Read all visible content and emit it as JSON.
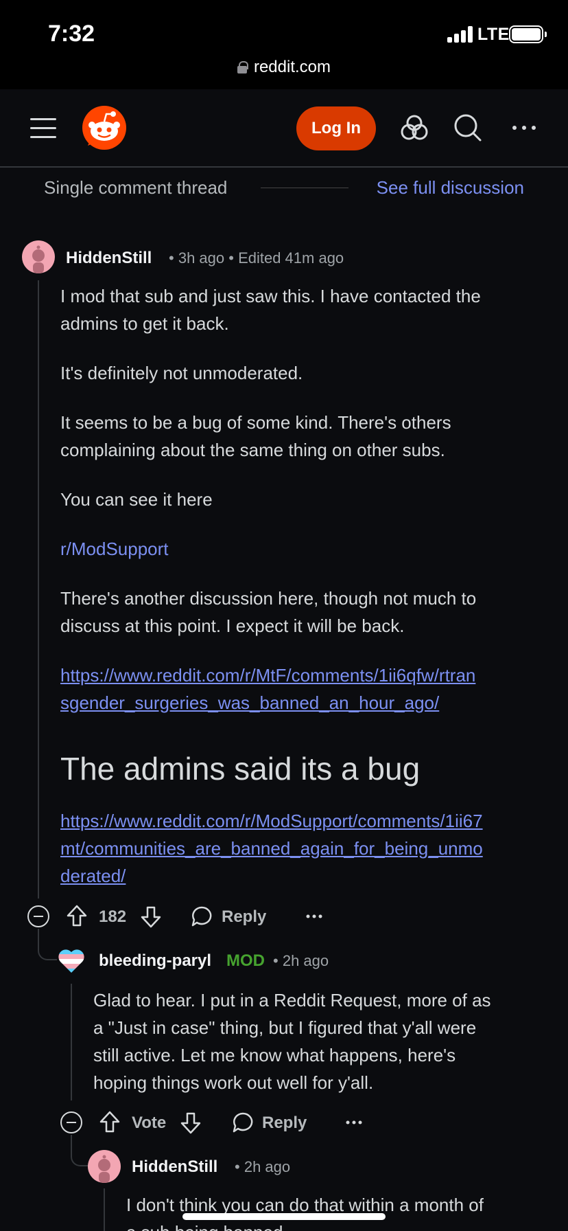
{
  "status_bar": {
    "time": "7:32",
    "network": "LTE",
    "url": "reddit.com"
  },
  "header": {
    "login_label": "Log In"
  },
  "thread_bar": {
    "label": "Single comment thread",
    "link": "See full discussion"
  },
  "comments": [
    {
      "author": "HiddenStill",
      "time": "3h ago",
      "edited": "Edited 41m ago",
      "paragraphs": [
        "I mod that sub and just saw this. I have contacted the admins to get it back.",
        "It's definitely not unmoderated.",
        "It seems to be a bug of some kind. There's others complaining about the same thing on other subs.",
        "You can see it here"
      ],
      "subreddit_link": "r/ModSupport",
      "paragraph2": "There's another discussion here, though not much to discuss at this point. I expect it will be back.",
      "url1_line1": "https://www.reddit.com/r/MtF/comments/1ii6qfw/rtran",
      "url1_line2": "sgender_surgeries_was_banned_an_hour_ago/",
      "heading": "The admins said its a bug",
      "url2_line1": "https://www.reddit.com/r/ModSupport/comments/1ii67",
      "url2_line2": "mt/communities_are_banned_again_for_being_unmo",
      "url2_line3": "derated/",
      "votes": "182",
      "reply_label": "Reply"
    },
    {
      "author": "bleeding-paryl",
      "flair": "MOD",
      "time": "2h ago",
      "text_lines": [
        "Glad to hear. I put in a Reddit Request, more of as",
        "a \"Just in case\" thing, but I figured that y'all were",
        "still active. Let me know what happens, here's",
        "hoping things work out well for y'all."
      ],
      "votes": "Vote",
      "reply_label": "Reply"
    },
    {
      "author": "HiddenStill",
      "time": "2h ago",
      "text_line1": "I don't think you can do that within a month of",
      "text_line2": "a sub being banned"
    }
  ],
  "colors": {
    "accent": "#d93a00",
    "link": "#7c90f2",
    "mod": "#46a32f",
    "background": "#0b0c0f"
  },
  "icons": [
    "lock-icon",
    "menu-icon",
    "reddit-logo",
    "popular-icon",
    "search-icon",
    "more-icon",
    "upvote-icon",
    "downvote-icon",
    "comment-icon",
    "collapse-icon"
  ]
}
